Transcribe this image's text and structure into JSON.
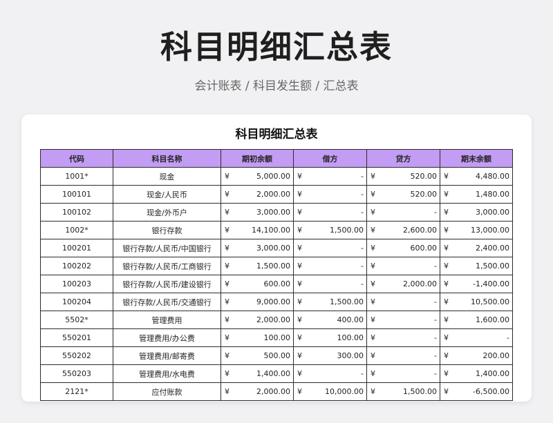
{
  "header": {
    "title": "科目明细汇总表",
    "subtitle": "会计账表 / 科目发生额 / 汇总表"
  },
  "sheet": {
    "title": "科目明细汇总表",
    "currency": "¥",
    "columns": [
      "代码",
      "科目名称",
      "期初余额",
      "借方",
      "贷方",
      "期末余额"
    ],
    "rows": [
      [
        "1001*",
        "现金",
        "5,000.00",
        "-",
        "520.00",
        "4,480.00"
      ],
      [
        "100101",
        "现金/人民币",
        "2,000.00",
        "-",
        "520.00",
        "1,480.00"
      ],
      [
        "100102",
        "现金/外币户",
        "3,000.00",
        "-",
        "-",
        "3,000.00"
      ],
      [
        "1002*",
        "银行存款",
        "14,100.00",
        "1,500.00",
        "2,600.00",
        "13,000.00"
      ],
      [
        "100201",
        "银行存款/人民币/中国银行",
        "3,000.00",
        "-",
        "600.00",
        "2,400.00"
      ],
      [
        "100202",
        "银行存款/人民币/工商银行",
        "1,500.00",
        "-",
        "-",
        "1,500.00"
      ],
      [
        "100203",
        "银行存款/人民币/建设银行",
        "600.00",
        "-",
        "2,000.00",
        "-1,400.00"
      ],
      [
        "100204",
        "银行存款/人民币/交通银行",
        "9,000.00",
        "1,500.00",
        "-",
        "10,500.00"
      ],
      [
        "5502*",
        "管理费用",
        "2,000.00",
        "400.00",
        "-",
        "1,600.00"
      ],
      [
        "550201",
        "管理费用/办公费",
        "100.00",
        "100.00",
        "-",
        "-"
      ],
      [
        "550202",
        "管理费用/邮寄费",
        "500.00",
        "300.00",
        "-",
        "200.00"
      ],
      [
        "550203",
        "管理费用/水电费",
        "1,400.00",
        "-",
        "-",
        "1,400.00"
      ],
      [
        "2121*",
        "应付账款",
        "2,000.00",
        "10,000.00",
        "1,500.00",
        "-6,500.00"
      ]
    ]
  }
}
